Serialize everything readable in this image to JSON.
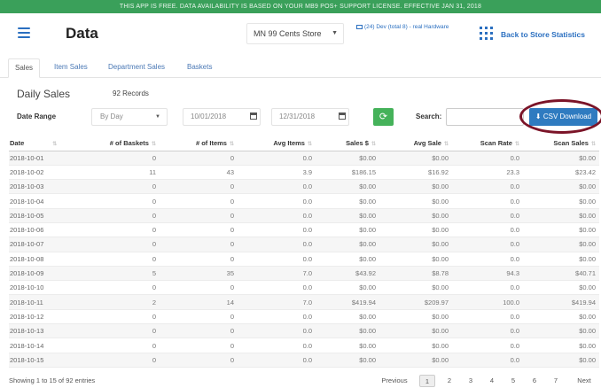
{
  "banner": {
    "text": "THIS APP IS FREE. DATA AVAILABILITY IS BASED ON YOUR MB9 POS+ SUPPORT LICENSE. EFFECTIVE JAN 31, 2018"
  },
  "header": {
    "title": "Data",
    "store": "MN 99 Cents Store",
    "device_info": "(24) Dev (total 8) - real Hardware",
    "back_link": "Back to Store Statistics"
  },
  "tabs": [
    "Sales",
    "Item Sales",
    "Department Sales",
    "Baskets"
  ],
  "daily": {
    "title": "Daily Sales",
    "records": "92 Records"
  },
  "filters": {
    "date_range_label": "Date Range",
    "period": "By Day",
    "start_date": "10/01/2018",
    "end_date": "12/31/2018",
    "search_label": "Search:",
    "search_value": "",
    "csv_label": "CSV Download"
  },
  "table": {
    "columns": [
      "Date",
      "# of Baskets",
      "# of Items",
      "Avg Items",
      "Sales $",
      "Avg Sale",
      "Scan Rate",
      "Scan Sales"
    ],
    "rows": [
      [
        "2018-10-01",
        "0",
        "0",
        "0.0",
        "$0.00",
        "$0.00",
        "0.0",
        "$0.00"
      ],
      [
        "2018-10-02",
        "11",
        "43",
        "3.9",
        "$186.15",
        "$16.92",
        "23.3",
        "$23.42"
      ],
      [
        "2018-10-03",
        "0",
        "0",
        "0.0",
        "$0.00",
        "$0.00",
        "0.0",
        "$0.00"
      ],
      [
        "2018-10-04",
        "0",
        "0",
        "0.0",
        "$0.00",
        "$0.00",
        "0.0",
        "$0.00"
      ],
      [
        "2018-10-05",
        "0",
        "0",
        "0.0",
        "$0.00",
        "$0.00",
        "0.0",
        "$0.00"
      ],
      [
        "2018-10-06",
        "0",
        "0",
        "0.0",
        "$0.00",
        "$0.00",
        "0.0",
        "$0.00"
      ],
      [
        "2018-10-07",
        "0",
        "0",
        "0.0",
        "$0.00",
        "$0.00",
        "0.0",
        "$0.00"
      ],
      [
        "2018-10-08",
        "0",
        "0",
        "0.0",
        "$0.00",
        "$0.00",
        "0.0",
        "$0.00"
      ],
      [
        "2018-10-09",
        "5",
        "35",
        "7.0",
        "$43.92",
        "$8.78",
        "94.3",
        "$40.71"
      ],
      [
        "2018-10-10",
        "0",
        "0",
        "0.0",
        "$0.00",
        "$0.00",
        "0.0",
        "$0.00"
      ],
      [
        "2018-10-11",
        "2",
        "14",
        "7.0",
        "$419.94",
        "$209.97",
        "100.0",
        "$419.94"
      ],
      [
        "2018-10-12",
        "0",
        "0",
        "0.0",
        "$0.00",
        "$0.00",
        "0.0",
        "$0.00"
      ],
      [
        "2018-10-13",
        "0",
        "0",
        "0.0",
        "$0.00",
        "$0.00",
        "0.0",
        "$0.00"
      ],
      [
        "2018-10-14",
        "0",
        "0",
        "0.0",
        "$0.00",
        "$0.00",
        "0.0",
        "$0.00"
      ],
      [
        "2018-10-15",
        "0",
        "0",
        "0.0",
        "$0.00",
        "$0.00",
        "0.0",
        "$0.00"
      ]
    ]
  },
  "footer": {
    "info": "Showing 1 to 15 of 92 entries",
    "previous": "Previous",
    "pages": [
      "1",
      "2",
      "3",
      "4",
      "5",
      "6",
      "7"
    ],
    "next": "Next"
  },
  "colors": {
    "banner": "#3aa05a",
    "accent": "#2f7bc0",
    "refresh": "#45b25a",
    "highlight_ring": "#7b1428"
  }
}
